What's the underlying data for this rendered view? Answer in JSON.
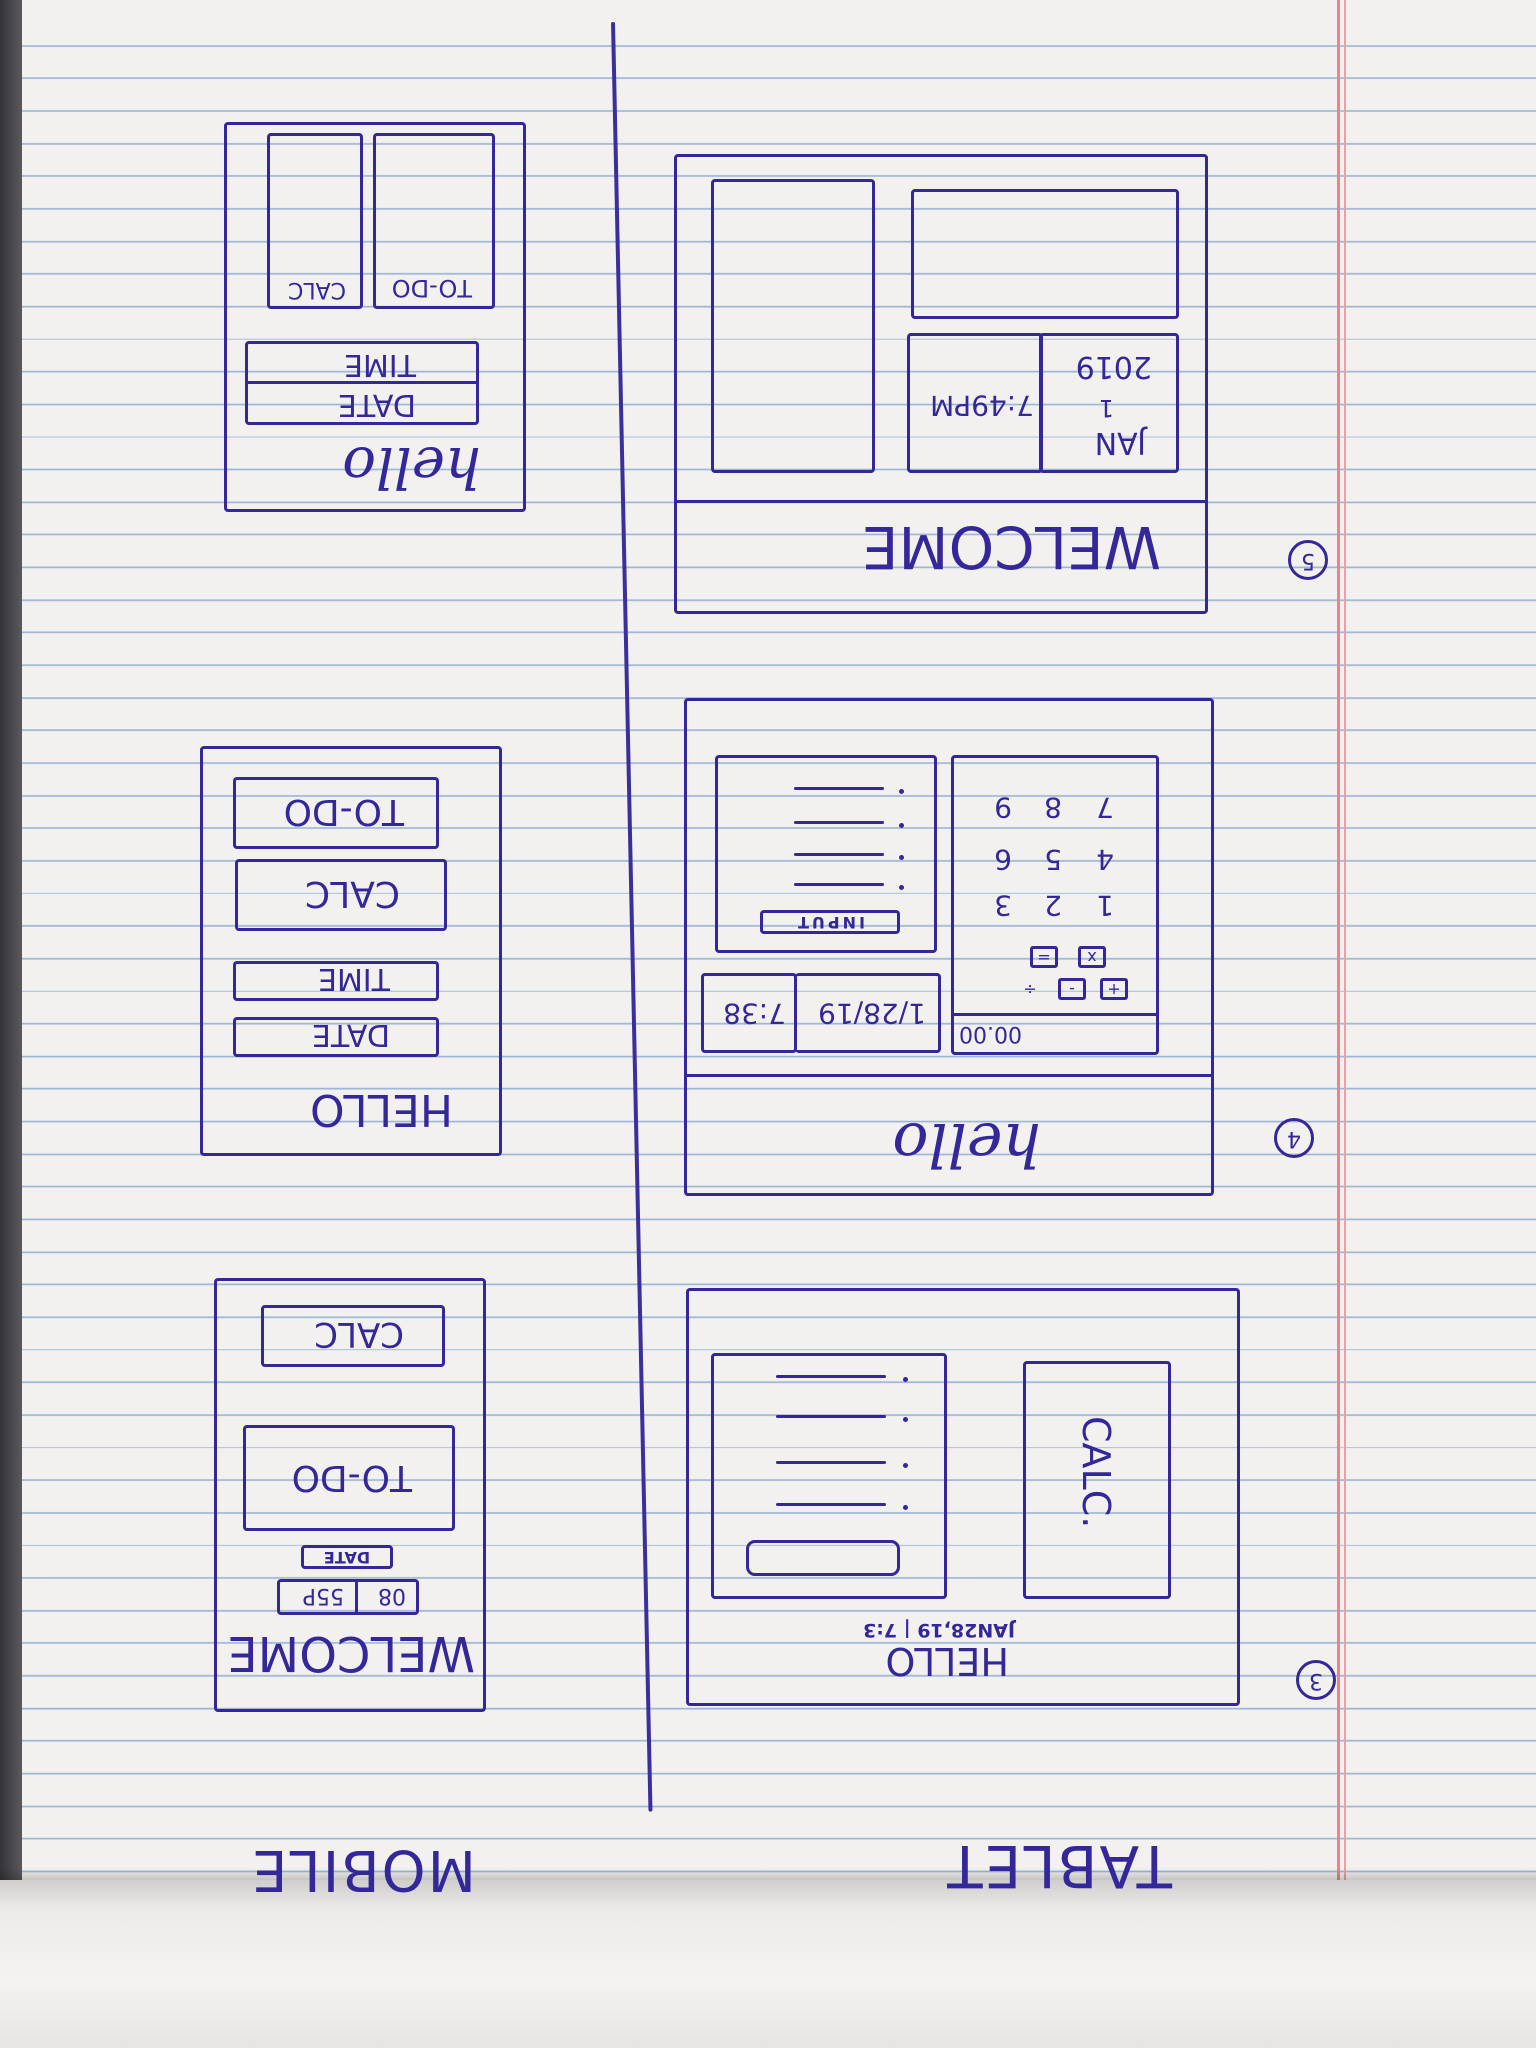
{
  "headings": {
    "mobile": "MOBILE",
    "tablet": "TABLET"
  },
  "tablet_3": {
    "number": "3",
    "title": "HELLO",
    "datetime": "JAN28,19 | 7:3",
    "calc_label": "CALC."
  },
  "tablet_4": {
    "number": "4",
    "greeting": "hello",
    "date": "1/28/19",
    "time": "7:38",
    "input_label": "INPUT",
    "display": "00.00",
    "ops": [
      "+",
      "-",
      "÷",
      "x",
      "="
    ],
    "digits": [
      [
        "1",
        "2",
        "3"
      ],
      [
        "4",
        "5",
        "6"
      ],
      [
        "7",
        "8",
        "9"
      ]
    ]
  },
  "tablet_5": {
    "number": "5",
    "title": "WELCOME",
    "month": "JAN",
    "day": "1",
    "year": "2019",
    "time": "7:49PM"
  },
  "mobile_a": {
    "title": "WELCOME",
    "hour": "08",
    "minutes": "55P",
    "date_label": "DATE",
    "todo_label": "TO-DO",
    "calc_label": "CALC"
  },
  "mobile_b": {
    "title": "HELLO",
    "date_label": "DATE",
    "time_label": "TIME",
    "calc_label": "CALC",
    "todo_label": "TO-DO"
  },
  "mobile_c": {
    "greeting": "hello",
    "date_label": "DATE",
    "time_label": "TIME",
    "calc_label": "CALC",
    "todo_label": "TO-DO"
  }
}
